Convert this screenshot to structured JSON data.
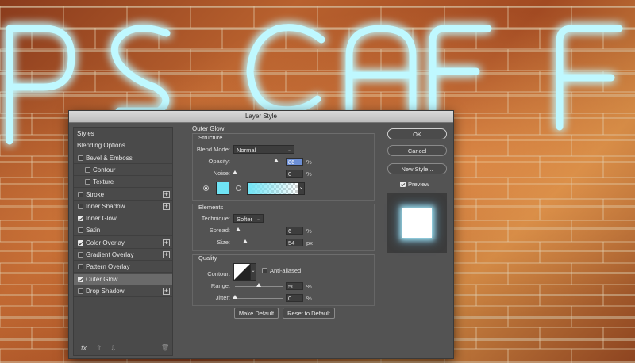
{
  "background": {
    "neon_text": "PS CAFE",
    "neon_color": "#7ff0ff",
    "wall_color": "#a24a22"
  },
  "dialog": {
    "title": "Layer Style",
    "styles_panel": {
      "items": [
        {
          "label": "Styles",
          "kind": "header"
        },
        {
          "label": "Blending Options",
          "kind": "header"
        },
        {
          "label": "Bevel & Emboss",
          "checked": false,
          "indent": 0,
          "has_add": false
        },
        {
          "label": "Contour",
          "checked": false,
          "indent": 1,
          "has_add": false
        },
        {
          "label": "Texture",
          "checked": false,
          "indent": 1,
          "has_add": false
        },
        {
          "label": "Stroke",
          "checked": false,
          "indent": 0,
          "has_add": true
        },
        {
          "label": "Inner Shadow",
          "checked": false,
          "indent": 0,
          "has_add": true
        },
        {
          "label": "Inner Glow",
          "checked": true,
          "indent": 0,
          "has_add": false
        },
        {
          "label": "Satin",
          "checked": false,
          "indent": 0,
          "has_add": false
        },
        {
          "label": "Color Overlay",
          "checked": true,
          "indent": 0,
          "has_add": true
        },
        {
          "label": "Gradient Overlay",
          "checked": false,
          "indent": 0,
          "has_add": true
        },
        {
          "label": "Pattern Overlay",
          "checked": false,
          "indent": 0,
          "has_add": false
        },
        {
          "label": "Outer Glow",
          "checked": true,
          "indent": 0,
          "has_add": false,
          "selected": true
        },
        {
          "label": "Drop Shadow",
          "checked": false,
          "indent": 0,
          "has_add": true
        }
      ],
      "footer": {
        "fx": "fx",
        "up": "⇧",
        "down": "⇩",
        "trash": "🗑"
      }
    },
    "outer_glow": {
      "title": "Outer Glow",
      "structure": {
        "label": "Structure",
        "blend_mode_label": "Blend Mode:",
        "blend_mode": "Normal",
        "opacity_label": "Opacity:",
        "opacity": "86",
        "opacity_fraction": 0.86,
        "noise_label": "Noise:",
        "noise": "0",
        "noise_fraction": 0.0,
        "unit": "%",
        "glow_color": "#6fe4f5"
      },
      "elements": {
        "label": "Elements",
        "technique_label": "Technique:",
        "technique": "Softer",
        "spread_label": "Spread:",
        "spread": "6",
        "spread_fraction": 0.06,
        "size_label": "Size:",
        "size": "54",
        "size_fraction": 0.21,
        "spread_unit": "%",
        "size_unit": "px"
      },
      "quality": {
        "label": "Quality",
        "contour_label": "Contour:",
        "anti_aliased_label": "Anti-aliased",
        "anti_aliased": false,
        "range_label": "Range:",
        "range": "50",
        "range_fraction": 0.5,
        "jitter_label": "Jitter:",
        "jitter": "0",
        "jitter_fraction": 0.0,
        "unit": "%"
      },
      "make_default": "Make Default",
      "reset_default": "Reset to Default"
    },
    "buttons": {
      "ok": "OK",
      "cancel": "Cancel",
      "new_style": "New Style...",
      "preview_label": "Preview",
      "preview_checked": true
    }
  }
}
